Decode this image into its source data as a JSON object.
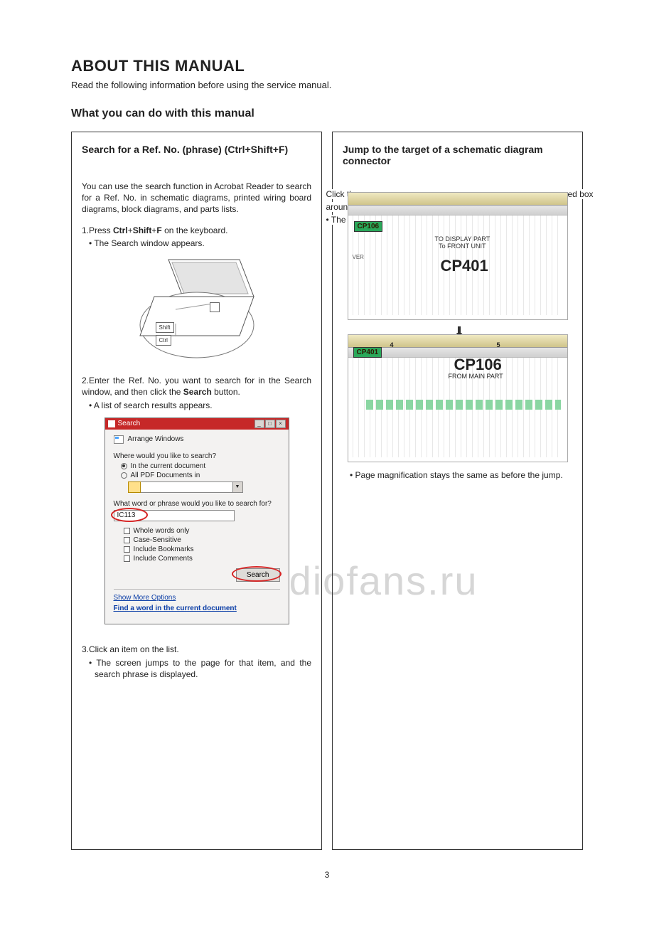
{
  "header": {
    "title": "ABOUT THIS MANUAL",
    "intro": "Read the following information before using the service manual.",
    "section": "What you can do with this manual"
  },
  "left_card": {
    "title": "Search for a Ref. No. (phrase) (Ctrl+Shift+F)",
    "para1": "You can use the search function in Acrobat Reader to search for a Ref. No. in schematic diagrams, printed wiring board diagrams, block diagrams, and parts lists.",
    "step1_pre": "1.Press ",
    "step1_k1": "Ctrl",
    "step1_plus1": "+",
    "step1_k2": "Shift",
    "step1_plus2": "+",
    "step1_k3": "F",
    "step1_post": " on the keyboard.",
    "step1_bullet": "The Search window appears.",
    "laptop_keys": {
      "shift": "Shift",
      "ctrl": "Ctrl"
    },
    "step2_line1": "2.Enter the Ref. No. you want to search for in the Search window, and then click the ",
    "step2_bold": "Search",
    "step2_line1_end": " button.",
    "step2_bullet": "A list of search results appears.",
    "dialog": {
      "title": "Search",
      "arrange": "Arrange Windows",
      "q1": "Where would you like to search?",
      "opt1": "In the current document",
      "opt2": "All PDF Documents in",
      "q2": "What word or phrase would you like to search for?",
      "value": "IC113",
      "chk1": "Whole words only",
      "chk2": "Case-Sensitive",
      "chk3": "Include Bookmarks",
      "chk4": "Include Comments",
      "btn": "Search",
      "link1": "Show More Options",
      "link2": "Find a word in the current document"
    },
    "step3": "3.Click an item on the list.",
    "step3_bullet": "The screen jumps to the page for that item, and the search phrase is displayed."
  },
  "right_card": {
    "title": "Jump to the target of a schematic diagram connector",
    "line1a": "Click th",
    "line1b": "ed box",
    "line2": "around",
    "line3": "The s",
    "schematic": {
      "cp106": "CP106",
      "cp401": "CP401",
      "to_display1": "TO DISPLAY PART",
      "to_display2": "To FRONT UNIT",
      "ver": "VER",
      "n4": "4",
      "n5": "5",
      "from_main": "FROM MAIN PART"
    },
    "bullet": "Page magnification stays the same as before the jump."
  },
  "watermark": "www.radiofans.ru",
  "page_number": "3"
}
